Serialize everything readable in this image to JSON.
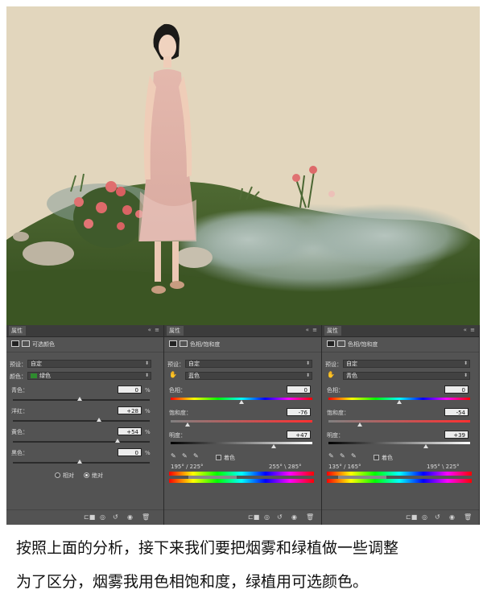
{
  "panels": [
    {
      "tab": "属性",
      "title": "可选颜色",
      "preset_label": "预设：",
      "preset_value": "自定",
      "color_label": "颜色：",
      "color_value": "绿色",
      "color_swatch": "#2e8b2e",
      "sliders": [
        {
          "label": "青色：",
          "value": "0",
          "unit": "%",
          "pos": 0.5
        },
        {
          "label": "洋红：",
          "value": "+28",
          "unit": "%",
          "pos": 0.64
        },
        {
          "label": "黄色：",
          "value": "+54",
          "unit": "%",
          "pos": 0.77
        },
        {
          "label": "黑色：",
          "value": "0",
          "unit": "%",
          "pos": 0.5
        }
      ],
      "mode_relative": "相对",
      "mode_absolute": "绝对",
      "mode_selected": "绝对"
    },
    {
      "tab": "属性",
      "title": "色相/饱和度",
      "preset_label": "预设：",
      "preset_value": "自定",
      "channel_value": "蓝色",
      "hue_label": "色相：",
      "hue_value": "0",
      "sat_label": "饱和度：",
      "sat_value": "-76",
      "light_label": "明度：",
      "light_value": "+47",
      "colorize_label": "着色",
      "range_left": "195° / 225°",
      "range_right": "255° \\ 285°"
    },
    {
      "tab": "属性",
      "title": "色相/饱和度",
      "preset_label": "预设：",
      "preset_value": "自定",
      "channel_value": "青色",
      "hue_label": "色相：",
      "hue_value": "0",
      "sat_label": "饱和度：",
      "sat_value": "-54",
      "light_label": "明度：",
      "light_value": "+39",
      "colorize_label": "着色",
      "range_left": "135° / 165°",
      "range_right": "195° \\ 225°"
    }
  ],
  "caption": {
    "line1": "按照上面的分析，接下来我们要把烟雾和绿植做一些调整",
    "line2": "为了区分，烟雾我用色相饱和度，绿植用可选颜色。"
  },
  "colors": {
    "panel_bg": "#535353",
    "photo_bg": "#e2d6bd"
  }
}
